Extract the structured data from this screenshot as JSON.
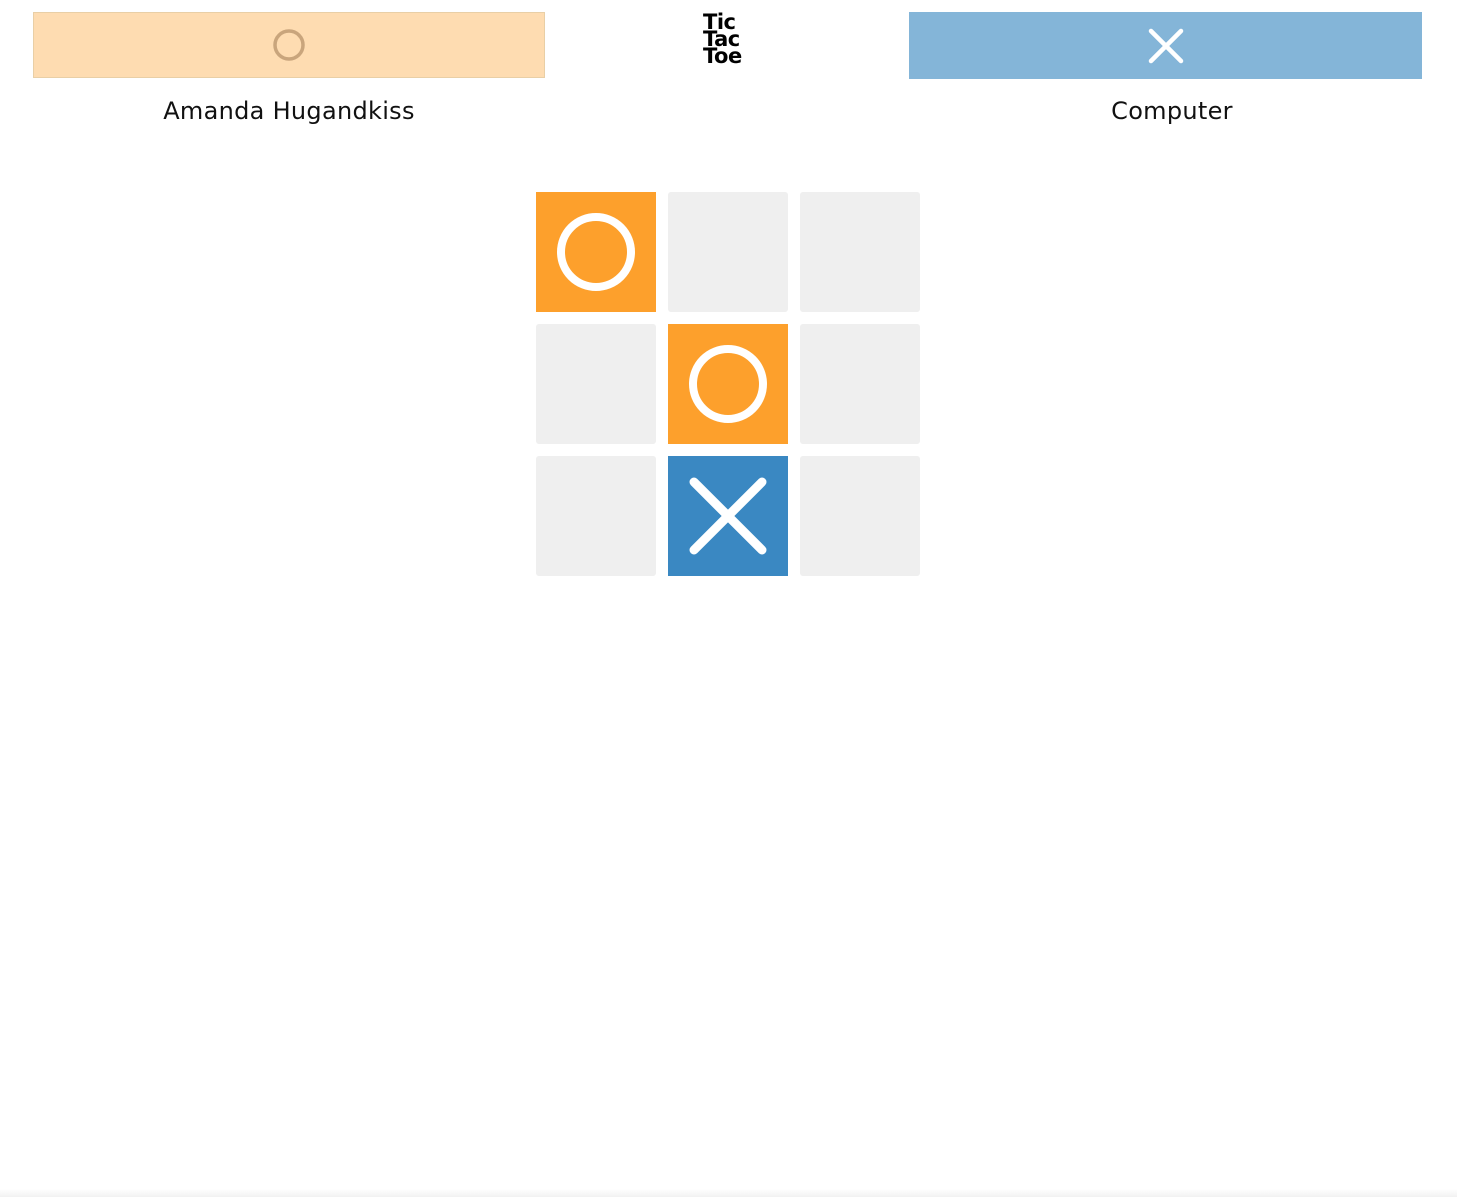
{
  "app": {
    "logo_lines": [
      "Tic",
      "Tac",
      "Toe"
    ]
  },
  "players": [
    {
      "mark": "O",
      "name": "Amanda Hugandkiss",
      "bar_color": "#fedcb1",
      "icon": "o-icon",
      "icon_color": "#c9a57c"
    },
    {
      "mark": "X",
      "name": "Computer",
      "bar_color": "#84b5d8",
      "icon": "x-icon",
      "icon_color": "#ffffff"
    }
  ],
  "board": {
    "cells": [
      "O",
      "",
      "",
      "",
      "O",
      "",
      "",
      "X",
      ""
    ],
    "o_color": "#fda02c",
    "x_color": "#3a88c2",
    "empty_color": "#efefef"
  }
}
